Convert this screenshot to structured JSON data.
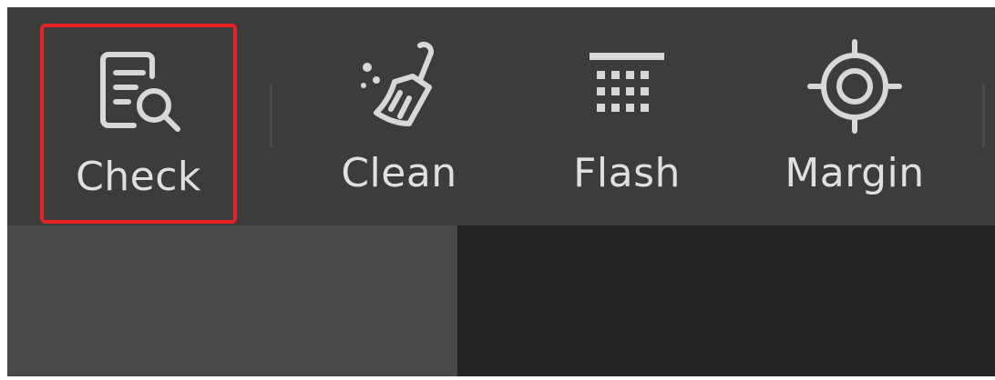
{
  "toolbar": {
    "selected_tool": "Check",
    "tools": [
      {
        "label": "Check",
        "icon": "check-document-magnifier-icon"
      },
      {
        "label": "Clean",
        "icon": "clean-brush-icon"
      },
      {
        "label": "Flash",
        "icon": "flash-grid-icon"
      },
      {
        "label": "Margin",
        "icon": "margin-target-icon"
      }
    ]
  },
  "colors": {
    "toolbar_bg": "#3c3c3c",
    "selection_border": "#e62121",
    "text": "#e0e0e0",
    "left_panel_bg": "#484848",
    "canvas_bg": "#242424"
  }
}
